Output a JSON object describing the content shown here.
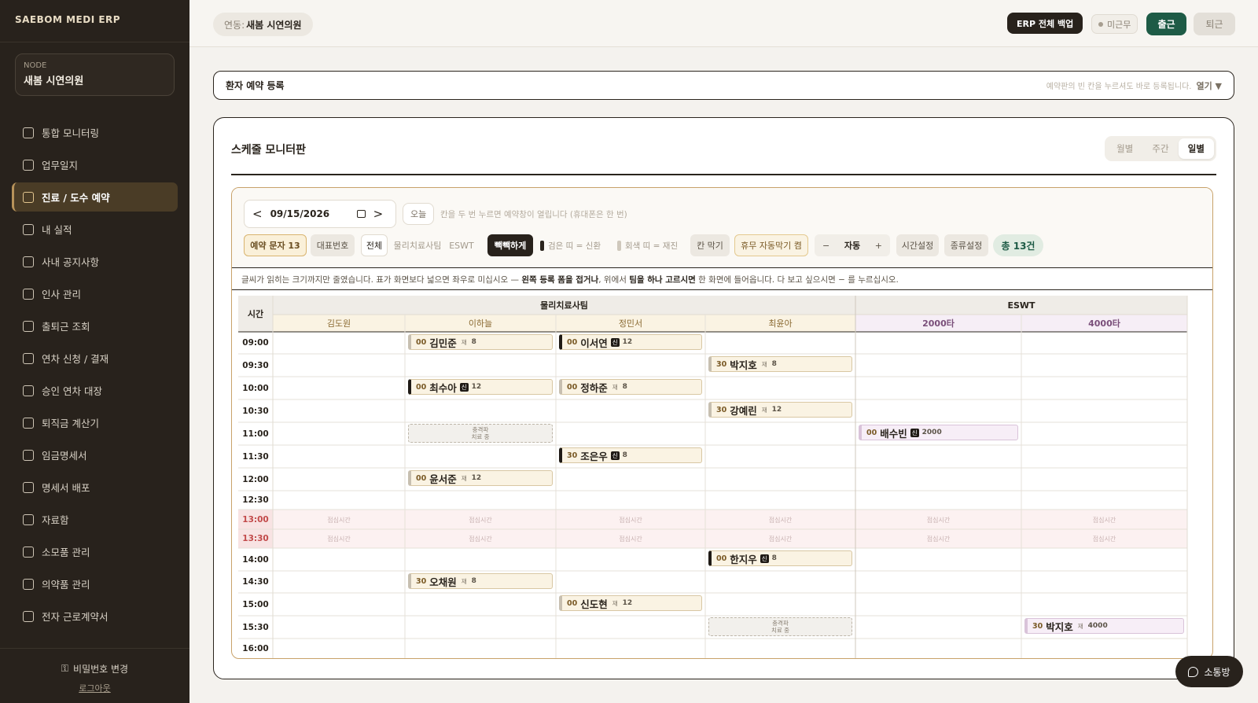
{
  "brand": "SAEBOM MEDI ERP",
  "node": {
    "label": "NODE",
    "name": "새봄 시연의원"
  },
  "nav": [
    {
      "label": "통합 모니터링",
      "icon": "dashboard-icon"
    },
    {
      "label": "업무일지",
      "icon": "journal-icon"
    },
    {
      "label": "진료 / 도수 예약",
      "icon": "calendar-icon",
      "active": true
    },
    {
      "label": "내 실적",
      "icon": "activity-icon"
    },
    {
      "label": "사내 공지사항",
      "icon": "megaphone-icon"
    },
    {
      "label": "인사 관리",
      "icon": "users-icon"
    },
    {
      "label": "출퇴근 조회",
      "icon": "clock-icon"
    },
    {
      "label": "연차 신청 / 결재",
      "icon": "plane-icon"
    },
    {
      "label": "승인 연차 대장",
      "icon": "folder-open-icon"
    },
    {
      "label": "퇴직금 계산기",
      "icon": "calculator-icon"
    },
    {
      "label": "임금명세서",
      "icon": "wallet-icon"
    },
    {
      "label": "명세서 배포",
      "icon": "send-doc-icon"
    },
    {
      "label": "자료함",
      "icon": "folder-icon"
    },
    {
      "label": "소모품 관리",
      "icon": "box-icon"
    },
    {
      "label": "의약품 관리",
      "icon": "pill-icon"
    },
    {
      "label": "전자 근로계약서",
      "icon": "contract-icon"
    }
  ],
  "footer": {
    "password_change": "비밀번호 변경",
    "logout": "로그아웃"
  },
  "topbar": {
    "branch_key": "연동:",
    "branch_value": "새봄 시연의원",
    "backup": "ERP 전체 백업",
    "status": "미근무",
    "clock_in": "출근",
    "clock_out": "퇴근"
  },
  "registration": {
    "title": "환자 예약 등록",
    "hint": "예약판의 빈 칸을 누르셔도 바로 등록됩니다.",
    "open": "열기 ▼"
  },
  "monitor": {
    "title": "스케줄 모니터판",
    "views": [
      "월별",
      "주간",
      "일별"
    ],
    "active_view": "일별",
    "date": "09/15/2026",
    "prev": "<",
    "next": ">",
    "today": "오늘",
    "hint": "칸을 두 번 누르면 예약창이 열립니다 (휴대폰은 한 번)",
    "chips": {
      "sms": "예약 문자 13",
      "rep": "대표번호",
      "all": "전체",
      "pt": "물리치료사팀",
      "eswt": "ESWT",
      "dense": "빽빽하게",
      "legend_new": "검은 띠 = 신환",
      "legend_ret": "회색 띠 = 재진",
      "block": "칸 막기",
      "auto_block": "휴무 자동막기 켬",
      "zoom_minus": "−",
      "zoom_label": "자동",
      "zoom_plus": "+",
      "time_set": "시간설정",
      "kind_set": "종류설정",
      "total": "총 13건"
    },
    "info": {
      "p1": "글씨가 읽히는 크기까지만 줄였습니다. 표가 화면보다 넓으면 좌우로 미십시오 — ",
      "b1": "왼쪽 등록 폼을 접거나",
      "p2": ", 위에서 ",
      "b2": "팀을 하나 고르시면",
      "p3": " 한 화면에 들어옵니다. 다 보고 싶으시면 − 를 누르십시오."
    },
    "time_header": "시간",
    "groups": [
      {
        "name": "물리치료사팀"
      },
      {
        "name": "ESWT"
      }
    ],
    "columns": [
      "김도원",
      "이하늘",
      "정민서",
      "최윤아",
      "2000타",
      "4000타"
    ],
    "times": [
      "09:00",
      "09:30",
      "10:00",
      "10:30",
      "11:00",
      "11:30",
      "12:00",
      "12:30",
      "13:00",
      "13:30",
      "14:00",
      "14:30",
      "15:00",
      "15:30",
      "16:00"
    ],
    "lunch_label": "점심시간",
    "block_label_1": "충격파",
    "block_label_2": "치료 중",
    "appointments": [
      {
        "col": 1,
        "slot": 0,
        "min": "00",
        "name": "김민준",
        "type": "재",
        "dur": "8"
      },
      {
        "col": 2,
        "slot": 0,
        "min": "00",
        "name": "이서연",
        "type": "신",
        "dur": "12"
      },
      {
        "col": 3,
        "slot": 1,
        "min": "30",
        "name": "박지호",
        "type": "재",
        "dur": "8"
      },
      {
        "col": 1,
        "slot": 2,
        "min": "00",
        "name": "최수아",
        "type": "신",
        "dur": "12"
      },
      {
        "col": 2,
        "slot": 2,
        "min": "00",
        "name": "정하준",
        "type": "재",
        "dur": "8"
      },
      {
        "col": 3,
        "slot": 3,
        "min": "30",
        "name": "강예린",
        "type": "재",
        "dur": "12"
      },
      {
        "col": 4,
        "slot": 4,
        "min": "00",
        "name": "배수빈",
        "type": "신",
        "dur": "2000"
      },
      {
        "col": 2,
        "slot": 5,
        "min": "30",
        "name": "조은우",
        "type": "신",
        "dur": "8"
      },
      {
        "col": 1,
        "slot": 6,
        "min": "00",
        "name": "윤서준",
        "type": "재",
        "dur": "12"
      },
      {
        "col": 3,
        "slot": 10,
        "min": "00",
        "name": "한지우",
        "type": "신",
        "dur": "8"
      },
      {
        "col": 1,
        "slot": 11,
        "min": "30",
        "name": "오채원",
        "type": "재",
        "dur": "8"
      },
      {
        "col": 2,
        "slot": 12,
        "min": "00",
        "name": "신도현",
        "type": "재",
        "dur": "12"
      },
      {
        "col": 5,
        "slot": 13,
        "min": "30",
        "name": "박지호",
        "type": "재",
        "dur": "4000"
      }
    ],
    "blocks": [
      {
        "col": 1,
        "slot": 4
      },
      {
        "col": 3,
        "slot": 13
      }
    ]
  },
  "chat": "소통방",
  "colors": {
    "sidebar": "#28221c",
    "accent_gold": "#c8a26a",
    "clock_in": "#1e5b46",
    "lunch": "#c24a4a"
  }
}
